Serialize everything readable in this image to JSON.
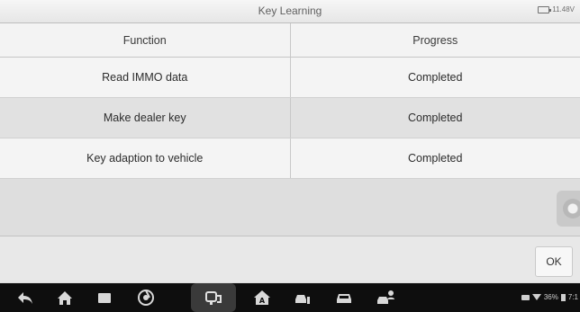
{
  "titlebar": {
    "title": "Key Learning",
    "battery_voltage": "11.48V",
    "battery_icon": "car-battery-icon"
  },
  "table": {
    "columns": [
      "Function",
      "Progress"
    ],
    "rows": [
      {
        "function": "Read IMMO data",
        "progress": "Completed"
      },
      {
        "function": "Make dealer key",
        "progress": "Completed"
      },
      {
        "function": "Key adaption to vehicle",
        "progress": "Completed"
      }
    ]
  },
  "floating_button": {
    "icon": "floating-menu-icon"
  },
  "actions": {
    "ok_label": "OK"
  },
  "navbar": {
    "icons": [
      "back-icon",
      "home-icon",
      "recent-apps-icon",
      "browser-icon",
      "vci-icon",
      "autel-home-icon",
      "car-shop-icon",
      "car-icon",
      "car-user-icon"
    ],
    "status_text": "36%",
    "time_text": "7:1"
  },
  "colors": {
    "navbar_bg": "#0e0e0e",
    "header_bg": "#f3f3f3",
    "row_alt_bg": "#e1e1e1"
  }
}
